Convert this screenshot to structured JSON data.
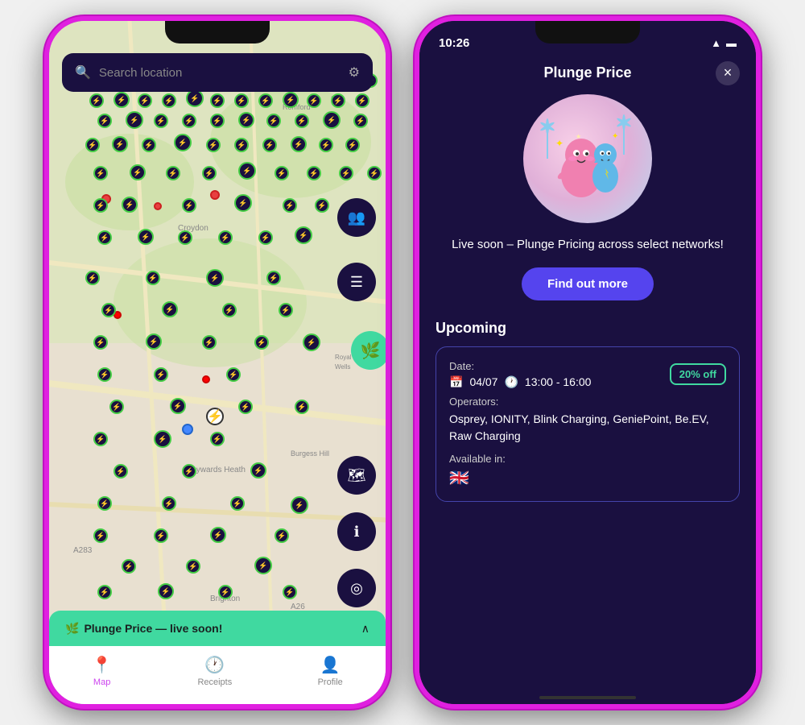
{
  "left_phone": {
    "search_placeholder": "Search location",
    "plunge_banner_text": "Plunge Price — live soon!",
    "tabs": [
      {
        "label": "Map",
        "icon": "📍",
        "active": true
      },
      {
        "label": "Receipts",
        "icon": "🕐",
        "active": false
      },
      {
        "label": "Profile",
        "icon": "👤",
        "active": false
      }
    ]
  },
  "right_phone": {
    "status_bar": {
      "time": "10:26",
      "icons": [
        "wifi",
        "battery"
      ]
    },
    "header": {
      "title": "Plunge Price",
      "close_label": "×"
    },
    "promo_text": "Live soon – Plunge Pricing across select networks!",
    "find_out_more": "Find out more",
    "upcoming_title": "Upcoming",
    "card": {
      "date_label": "Date:",
      "date": "04/07",
      "time": "13:00 - 16:00",
      "discount": "20% off",
      "operators_label": "Operators:",
      "operators": "Osprey, IONITY, Blink Charging, GeniePoint, Be.EV, Raw Charging",
      "available_label": "Available in:",
      "flag": "🇬🇧"
    }
  }
}
